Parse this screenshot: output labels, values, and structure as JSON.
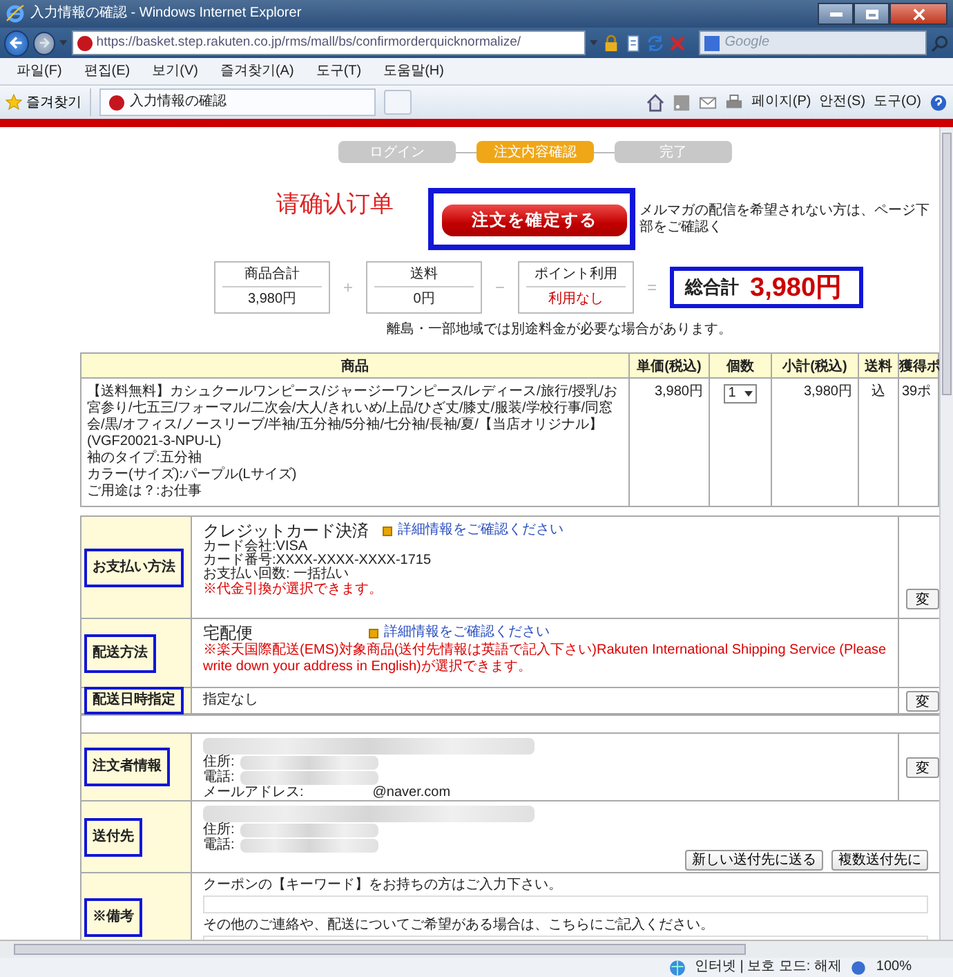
{
  "window": {
    "title": "入力情報の確認 - Windows Internet Explorer"
  },
  "address_bar": {
    "url": "https://basket.step.rakuten.co.jp/rms/mall/bs/confirmorderquicknormalize/"
  },
  "search": {
    "placeholder": "Google"
  },
  "menu": [
    "파일(F)",
    "편집(E)",
    "보기(V)",
    "즐겨찾기(A)",
    "도구(T)",
    "도움말(H)"
  ],
  "favorites_bar": {
    "label": "즐겨찾기",
    "tab": "入力情報の確認",
    "tools": [
      "페이지(P)",
      "안전(S)",
      "도구(O)"
    ]
  },
  "steps": [
    {
      "label": "ログイン",
      "selected": false
    },
    {
      "label": "注文内容確認",
      "selected": true
    },
    {
      "label": "完了",
      "selected": false
    }
  ],
  "heading": "请确认订单",
  "confirm_button": "注文を確定する",
  "newsletter_note": "メルマガの配信を希望されない方は、ページ下部をご確認く",
  "summary": {
    "items": [
      {
        "label": "商品合計",
        "value": "3,980円",
        "highlight": false
      },
      {
        "label": "送料",
        "value": "0円",
        "highlight": false
      },
      {
        "label": "ポイント利用",
        "value": "利用なし",
        "highlight": true
      }
    ],
    "operators": [
      "+",
      "−",
      "="
    ],
    "total": {
      "label": "総合計",
      "value": "3,980円"
    }
  },
  "shipping_note": "離島・一部地域では別途料金が必要な場合があります。",
  "cart": {
    "columns": [
      "商品",
      "単価(税込)",
      "個数",
      "小計(税込)",
      "送料",
      "獲得ポ"
    ],
    "rows": [
      {
        "product_lines": [
          "【送料無料】カシュクールワンピース/ジャージーワンピース/レディース/旅行/授乳/お宮参り/七五三/フォーマル/二次会/大人/きれいめ/上品/ひざ丈/膝丈/服装/学校行事/同窓会/黒/オフィス/ノースリーブ/半袖/五分袖/5分袖/七分袖/長袖/夏/【当店オリジナル】(VGF20021-3-NPU-L)",
          "袖のタイプ:五分袖",
          "カラー(サイズ):パープル(Lサイズ)",
          "ご用途は？:お仕事"
        ],
        "unit_price": "3,980円",
        "quantity": "1",
        "subtotal": "3,980円",
        "shipping": "込",
        "points": "39ポ"
      }
    ]
  },
  "sections": [
    {
      "kind": "payment",
      "label": "お支払い方法",
      "title": "クレジットカード決済",
      "link": "詳細情報をご確認ください",
      "lines": [
        "カード会社:VISA",
        "カード番号:XXXX-XXXX-XXXX-1715",
        "お支払い回数: 一括払い"
      ],
      "notice": "※代金引換が選択できます。",
      "button": "変"
    },
    {
      "kind": "shipping",
      "label": "配送方法",
      "title": "宅配便",
      "link": "詳細情報をご確認ください",
      "notice": "※楽天国際配送(EMS)対象商品(送付先情報は英語で記入下さい)Rakuten International Shipping Service (Please write down your address in English)が選択できます。"
    },
    {
      "kind": "date",
      "label": "配送日時指定",
      "value": "指定なし",
      "button": "変"
    },
    {
      "kind": "orderer",
      "label": "注文者情報",
      "lines": [
        "住所:",
        "電話:"
      ],
      "email_label": "メールアドレス:",
      "email": "@naver.com",
      "button": "変"
    },
    {
      "kind": "destination",
      "label": "送付先",
      "lines": [
        "住所:",
        "電話:"
      ],
      "buttons": [
        "新しい送付先に送る",
        "複数送付先に"
      ]
    },
    {
      "kind": "remarks",
      "label": "※備考",
      "prompts": [
        "クーポンの【キーワード】をお持ちの方はご入力下さい。",
        "その他のご連絡や、配送についてご希望がある場合は、こちらにご記入ください。"
      ]
    }
  ],
  "status_bar": {
    "zone": "인터넷 | 보호 모드: 해제",
    "zoom": "100%"
  }
}
